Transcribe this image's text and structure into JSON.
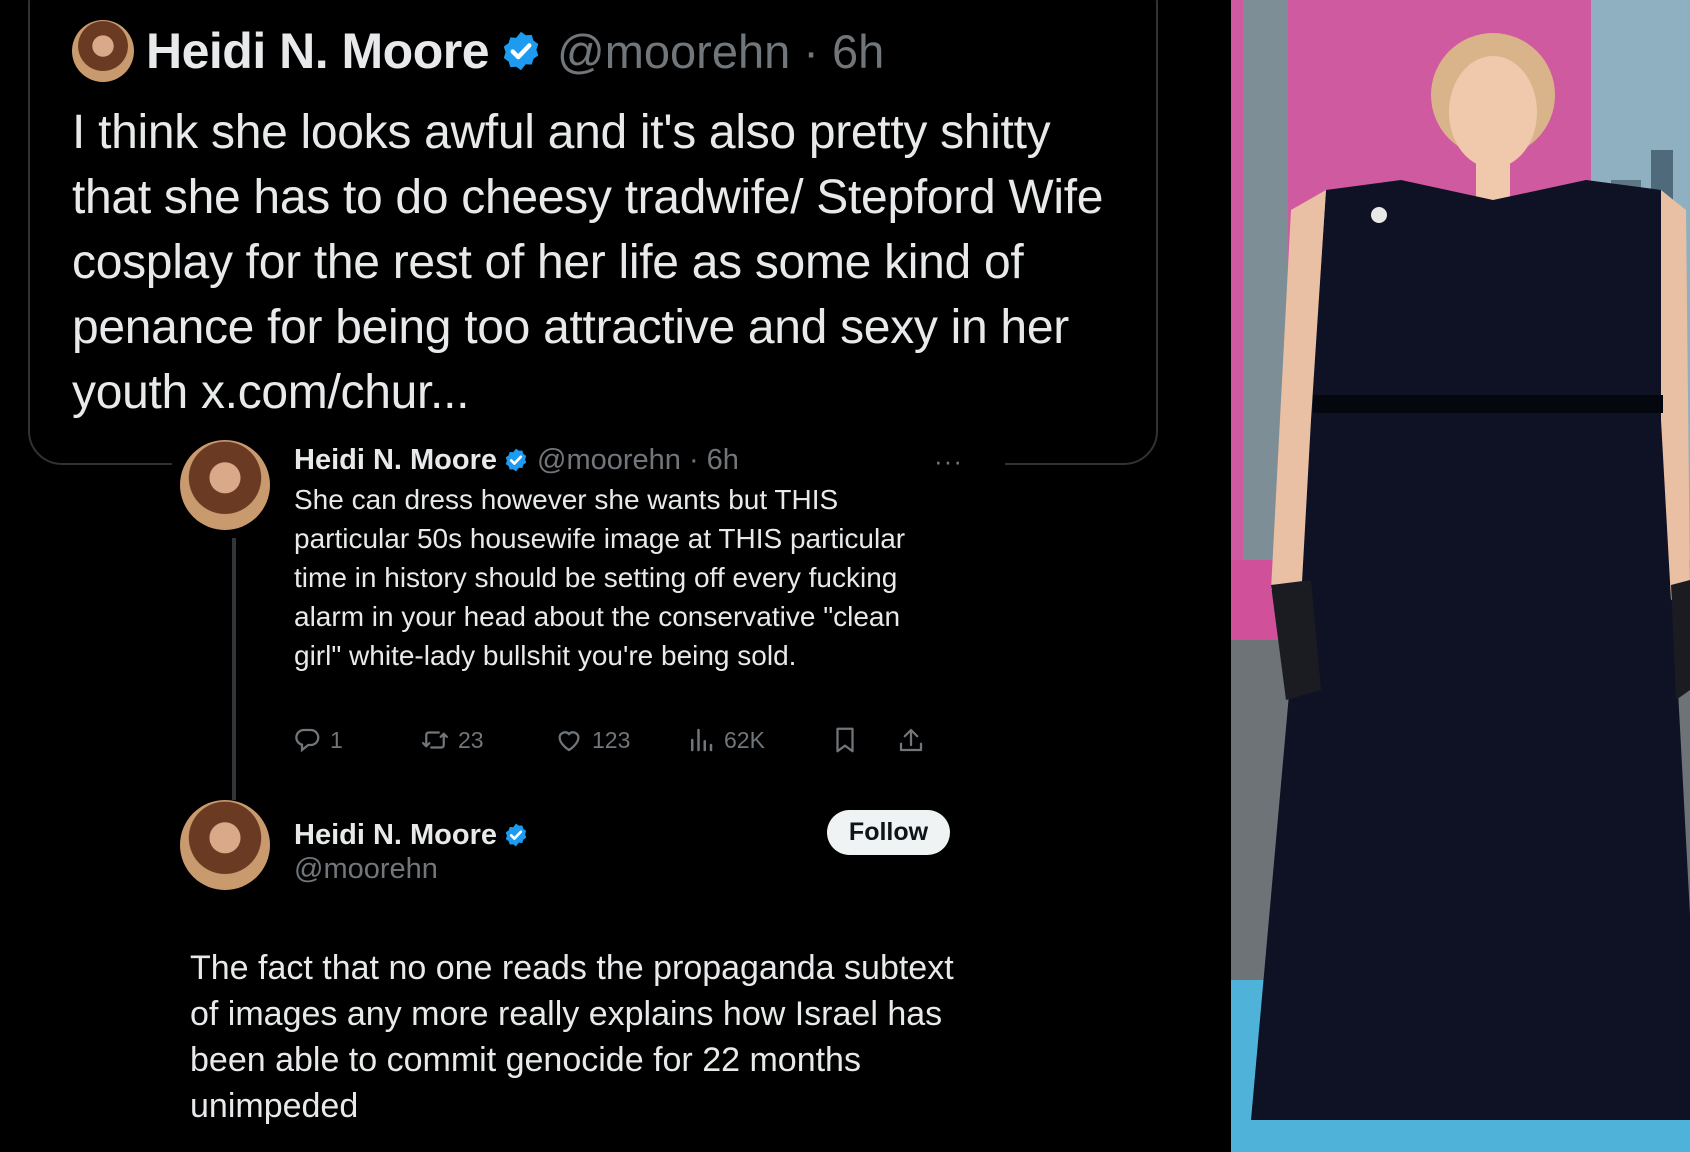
{
  "quote_tweet": {
    "name": "Heidi N. Moore",
    "handle_time": "@moorehn · 6h",
    "text": "I think she looks awful and it's also pretty shitty that she has to do cheesy tradwife/ Stepford Wife cosplay for the rest of her life as some kind of penance for being too attractive and sexy in her youth x.com/chur..."
  },
  "tweet1": {
    "name": "Heidi N. Moore",
    "handle_time": "@moorehn · 6h",
    "more": "···",
    "text": "She can dress however she wants but THIS particular 50s housewife image at THIS particular time in history should be setting off every fucking alarm in your head about the conservative \"clean girl\" white-lady bullshit you're being sold.",
    "replies": "1",
    "reposts": "23",
    "likes": "123",
    "views": "62K"
  },
  "tweet2": {
    "name": "Heidi N. Moore",
    "handle": "@moorehn",
    "follow_label": "Follow",
    "text": "The fact that no one reads the propaganda subtext of images any more really explains how Israel has been able to commit genocide for 22 months unimpeded"
  },
  "icons": {
    "verified": "verified-badge-icon",
    "reply": "reply-icon",
    "repost": "repost-icon",
    "like": "heart-icon",
    "views": "views-icon",
    "bookmark": "bookmark-icon",
    "share": "share-icon"
  },
  "colors": {
    "background": "#000000",
    "text": "#e7e9ea",
    "secondary": "#71767b",
    "verified": "#1d9bf0",
    "border": "#2f3336",
    "photo_backdrop": "#e05ca8",
    "carpet": "#4fb3d9",
    "dress": "#0e1224"
  }
}
